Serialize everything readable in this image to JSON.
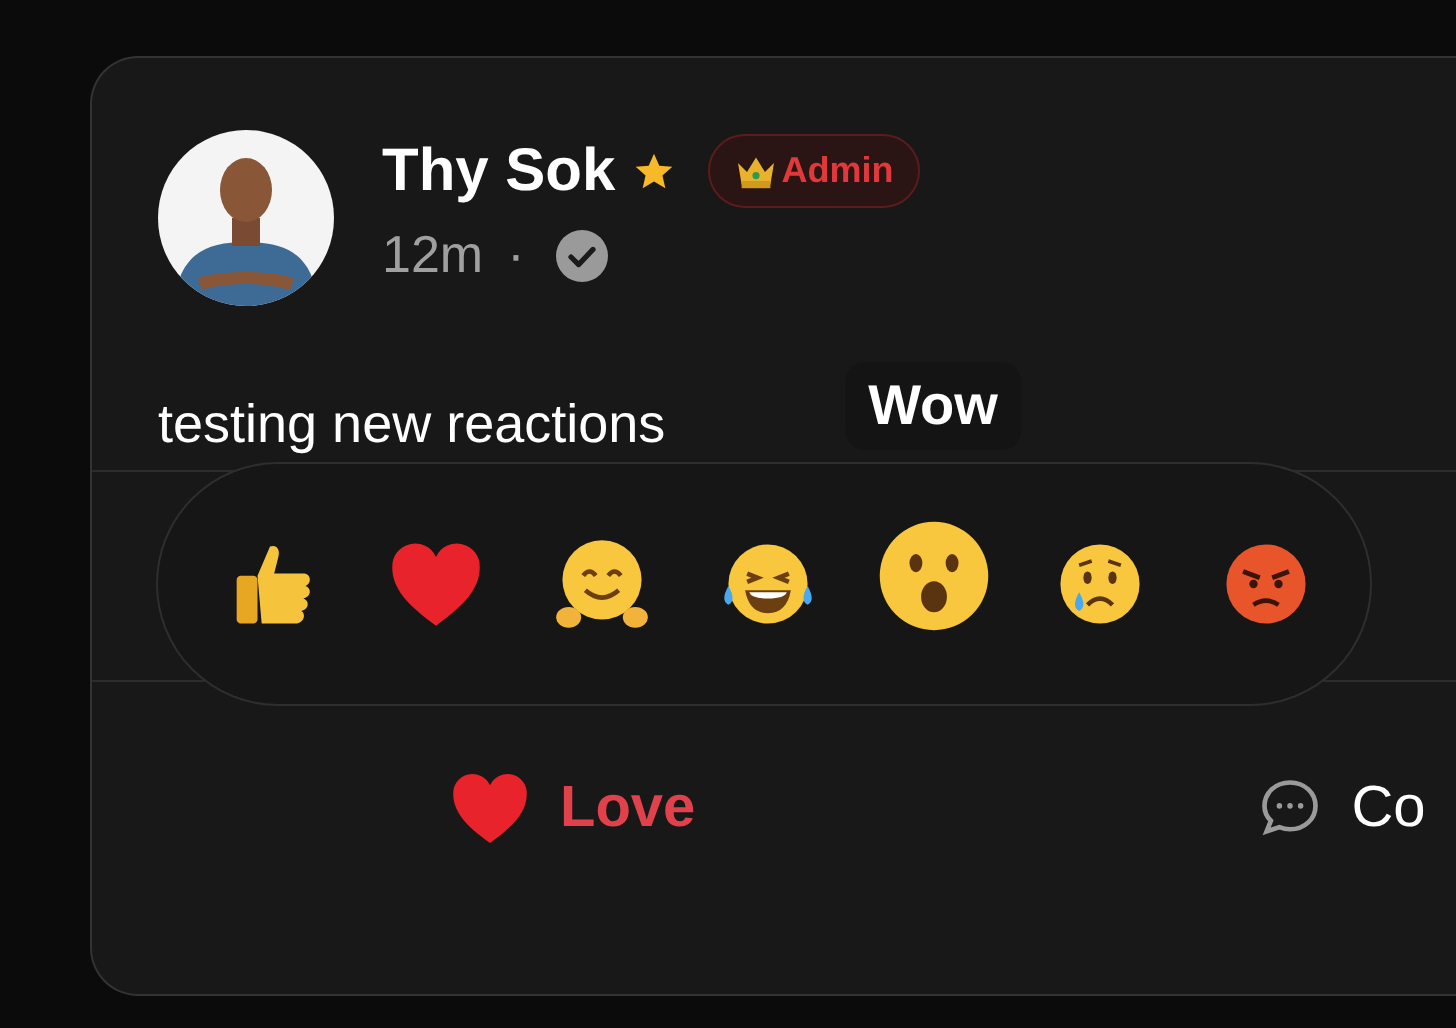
{
  "post": {
    "author": {
      "name": "Thy Sok",
      "starred": true,
      "badge": "Admin"
    },
    "time": "12m",
    "separator": "·",
    "verified": true,
    "text": "testing new reactions"
  },
  "reaction_picker": {
    "tooltip": "Wow",
    "reactions": [
      {
        "kind": "like",
        "selected": false
      },
      {
        "kind": "love",
        "selected": false
      },
      {
        "kind": "care",
        "selected": false
      },
      {
        "kind": "haha",
        "selected": false
      },
      {
        "kind": "wow",
        "selected": true
      },
      {
        "kind": "sad",
        "selected": false
      },
      {
        "kind": "angry",
        "selected": false
      }
    ]
  },
  "actions": [
    {
      "kind": "react",
      "label": "Love",
      "active": true
    },
    {
      "kind": "comment",
      "label": "Co",
      "active": false
    }
  ]
}
